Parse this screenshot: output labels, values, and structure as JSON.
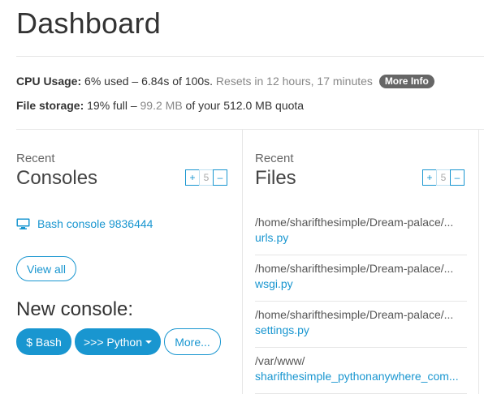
{
  "page": {
    "title": "Dashboard"
  },
  "quota": {
    "cpu_label": "CPU Usage:",
    "cpu_used": "6% used – 6.84s of 100s.",
    "cpu_reset": "Resets in 12 hours, 17 minutes",
    "more_info": "More Info",
    "storage_label": "File storage:",
    "storage_pct": "19% full –",
    "storage_used": "99.2 MB",
    "storage_quota": "of your 512.0 MB quota"
  },
  "consoles": {
    "kicker": "Recent",
    "title": "Consoles",
    "stepper": {
      "plus": "+",
      "count": "5",
      "minus": "–"
    },
    "items": [
      {
        "label": "Bash console 9836444",
        "icon": "monitor-icon"
      }
    ],
    "view_all": "View all",
    "new_console_title": "New console:",
    "new_buttons": {
      "bash": "$ Bash",
      "python": ">>> Python",
      "more": "More..."
    }
  },
  "files": {
    "kicker": "Recent",
    "title": "Files",
    "stepper": {
      "plus": "+",
      "count": "5",
      "minus": "–"
    },
    "items": [
      {
        "path": "/home/sharifthesimple/Dream-palace/...",
        "name": "urls.py"
      },
      {
        "path": "/home/sharifthesimple/Dream-palace/...",
        "name": "wsgi.py"
      },
      {
        "path": "/home/sharifthesimple/Dream-palace/...",
        "name": "settings.py"
      },
      {
        "path": "/var/www/",
        "name": "sharifthesimple_pythonanywhere_com..."
      }
    ]
  },
  "colors": {
    "accent": "#1996d0",
    "badge": "#666666",
    "muted": "#888888"
  }
}
